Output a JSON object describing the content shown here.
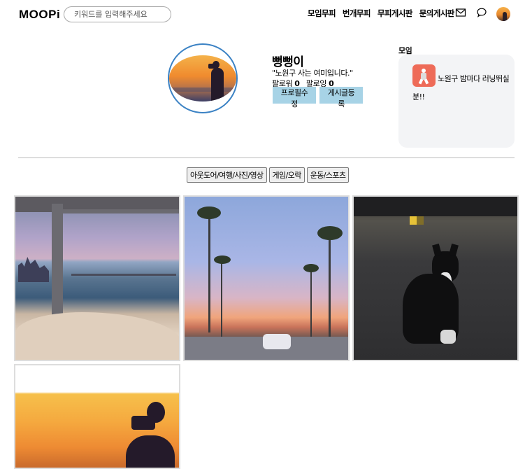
{
  "header": {
    "logo": "MOOPi",
    "search_placeholder": "키워드를 입력해주세요",
    "nav": [
      "모임무피",
      "번개무피",
      "무피게시판",
      "문의게시판"
    ],
    "icons": [
      "mail-icon",
      "chat-icon",
      "user-avatar"
    ]
  },
  "profile": {
    "name": "뻥뻥이",
    "bio": "\"노원구 사는 여미입니다.\"",
    "followers_label": "팔로워",
    "followers_count": "0",
    "following_label": "팔로잉",
    "following_count": "0",
    "edit_button": "프로필수정",
    "post_button": "게시글등록"
  },
  "group": {
    "title": "모임",
    "name": "노원구 밤마다 러닝뛰실분!!"
  },
  "categories": [
    "아웃도어/여행/사진/영상",
    "게임/오락",
    "운동/스포츠"
  ],
  "gallery": {
    "photos": [
      "beach-window-photo",
      "palm-street-photo",
      "cat-photo",
      "sunset-photographer-photo"
    ]
  },
  "colors": {
    "accent_button": "#a7d3e6",
    "profile_border": "#3b82c4",
    "group_card_bg": "#f3f4f6"
  }
}
